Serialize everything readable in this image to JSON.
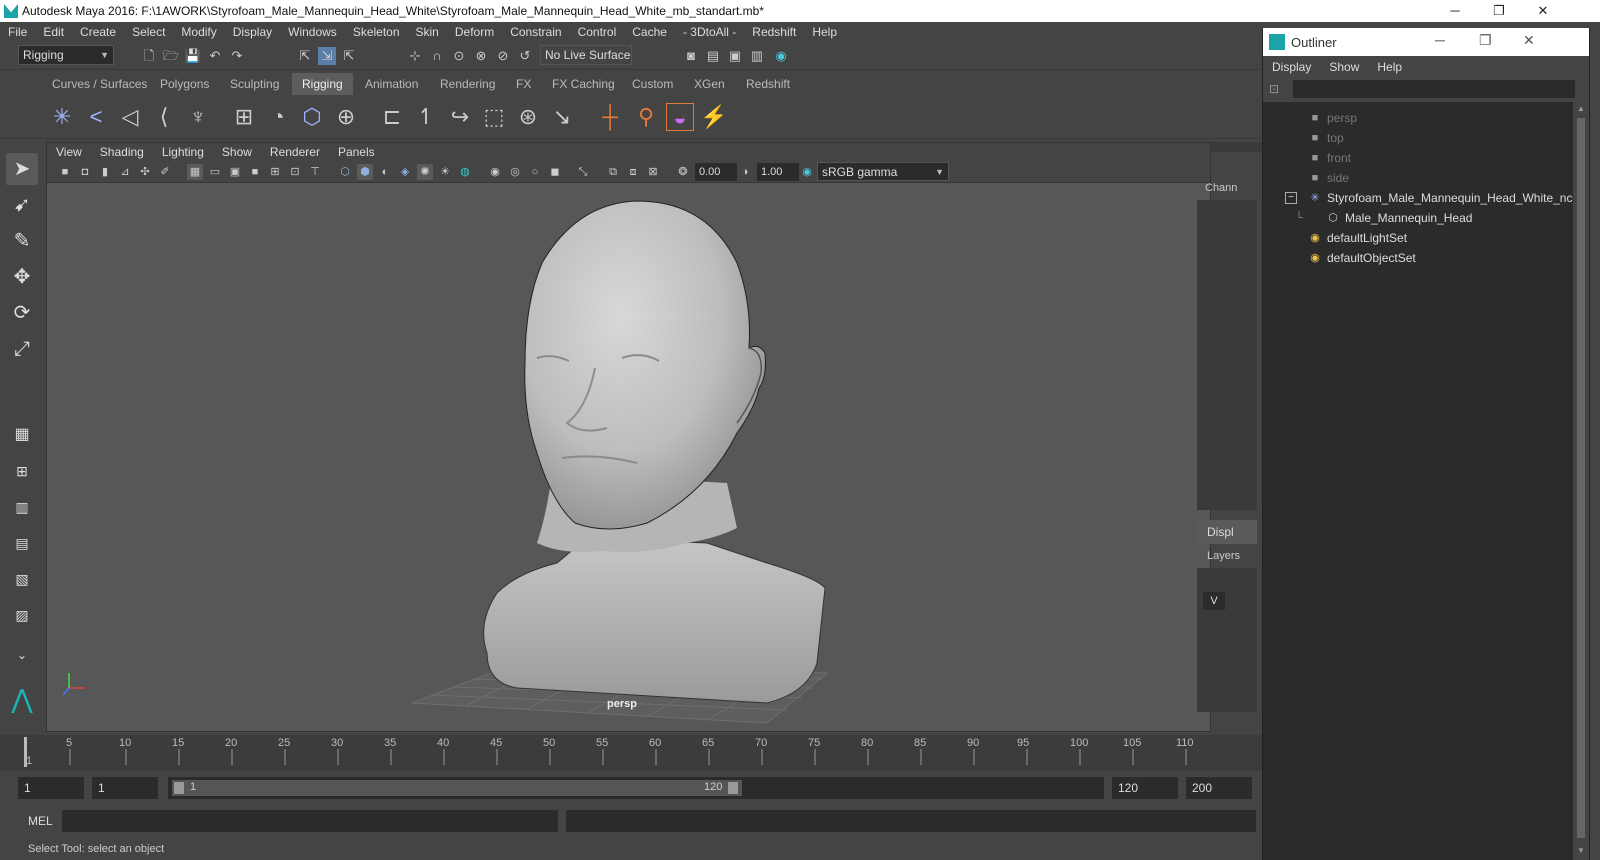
{
  "window": {
    "title": "Autodesk Maya 2016: F:\\1AWORK\\Styrofoam_Male_Mannequin_Head_White\\Styrofoam_Male_Mannequin_Head_White_mb_standart.mb*",
    "minimize": "─",
    "restore": "❐",
    "close": "✕"
  },
  "menubar": [
    "File",
    "Edit",
    "Create",
    "Select",
    "Modify",
    "Display",
    "Windows",
    "Skeleton",
    "Skin",
    "Deform",
    "Constrain",
    "Control",
    "Cache",
    "- 3DtoAll -",
    "Redshift",
    "Help"
  ],
  "statusline": {
    "mode": "Rigging",
    "live_surface": "No Live Surface"
  },
  "shelf_tabs": [
    {
      "label": "Curves / Surfaces",
      "active": false
    },
    {
      "label": "Polygons",
      "active": false
    },
    {
      "label": "Sculpting",
      "active": false
    },
    {
      "label": "Rigging",
      "active": true
    },
    {
      "label": "Animation",
      "active": false
    },
    {
      "label": "Rendering",
      "active": false
    },
    {
      "label": "FX",
      "active": false
    },
    {
      "label": "FX Caching",
      "active": false
    },
    {
      "label": "Custom",
      "active": false
    },
    {
      "label": "XGen",
      "active": false
    },
    {
      "label": "Redshift",
      "active": false
    }
  ],
  "viewport": {
    "menu": [
      "View",
      "Shading",
      "Lighting",
      "Show",
      "Renderer",
      "Panels"
    ],
    "exposure": "0.00",
    "gamma": "1.00",
    "color_space": "sRGB gamma",
    "camera": "persp",
    "colors": {
      "background": "#575757",
      "model": "#c8c8c8",
      "grid": "#6e6e6e"
    }
  },
  "side_panel": {
    "channel_box": "Chann",
    "display_tab": "Displ",
    "layers": "Layers",
    "v_label": "V"
  },
  "timeline": {
    "ticks": [
      "5",
      "10",
      "15",
      "20",
      "25",
      "30",
      "35",
      "40",
      "45",
      "50",
      "55",
      "60",
      "65",
      "70",
      "75",
      "80",
      "85",
      "90",
      "95",
      "100",
      "105",
      "110"
    ],
    "current_frame": "1"
  },
  "range": {
    "start": "1",
    "anim_start": "1",
    "slider_start": "1",
    "slider_end": "120",
    "end": "120",
    "anim_end": "200"
  },
  "command_line": {
    "language": "MEL"
  },
  "help_line": "Select Tool: select an object",
  "outliner": {
    "title": "Outliner",
    "menu": [
      "Display",
      "Show",
      "Help"
    ],
    "items": [
      {
        "label": "persp",
        "dim": true
      },
      {
        "label": "top",
        "dim": true
      },
      {
        "label": "front",
        "dim": true
      },
      {
        "label": "side",
        "dim": true
      },
      {
        "label": "Styrofoam_Male_Mannequin_Head_White_ncl",
        "dim": false
      },
      {
        "label": "Male_Mannequin_Head",
        "dim": false
      },
      {
        "label": "defaultLightSet",
        "dim": false
      },
      {
        "label": "defaultObjectSet",
        "dim": false
      }
    ]
  }
}
